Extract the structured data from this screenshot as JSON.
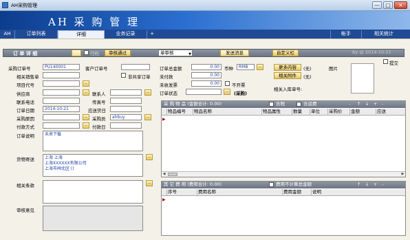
{
  "window": {
    "title": "AH采购管理",
    "buttons": [
      "—",
      "□",
      "×"
    ]
  },
  "banner": {
    "app_title": "AH 采 购 管 理"
  },
  "tabs": [
    {
      "label": "AH"
    },
    {
      "label": "订单列表"
    },
    {
      "label": "详细"
    },
    {
      "label": "业务记录"
    },
    {
      "label": "+"
    }
  ],
  "right_tabs": [
    {
      "label": "帐手"
    },
    {
      "label": "相关统计"
    }
  ],
  "toolbar": {
    "title": "订 单 详 细",
    "checkbox_label": "归档",
    "audit_button": "审核通过",
    "status_select": "单审核",
    "send_button": "发送消息",
    "custom_button": "自定义栏",
    "by_date": "By  @ 2014-10-21"
  },
  "form": {
    "labels": {
      "order_no": "采购订单号",
      "customer_order": "客户订单号",
      "related_sales": "相关销售单",
      "project_code": "项目代号",
      "supplier": "供应商",
      "contact": "联系人",
      "contact_phone": "联系电话",
      "fax": "传真号",
      "order_date": "订单日期",
      "due_date": "应送货日",
      "purchase_reason": "采购原因",
      "buyer": "采购员",
      "payment_method": "付款方式",
      "payment_date": "付款日",
      "order_note": "订单说明",
      "delivery": "货物寄送",
      "terms": "相关条款",
      "audit_opinion": "审核意见",
      "non_original": "非共享订单",
      "total_amount": "订单总金额",
      "currency": "币种",
      "unpaid": "未付款",
      "uninvoiced": "未收发票",
      "no_invoice": "不开票",
      "order_status": "订单状态",
      "status_suffix": "(采购)",
      "more_content": "更多内容",
      "more_content_suffix": "(无)",
      "attachments": "相关附件",
      "attachments_suffix": "(无)",
      "picture": "图片",
      "related_entry": "相关入库单号:",
      "submit_check": "提交"
    },
    "values": {
      "order_no": "PU140001",
      "order_date": "2014-10-21",
      "buyer": "ahbuy",
      "order_note": "未来下载",
      "delivery_lines": [
        "上海 上海",
        "上海XXXXXX有限公司",
        "上海市闸北区 ()"
      ],
      "total_amount": "0.00",
      "currency": "RMB",
      "unpaid": "0.00",
      "uninvoiced": "0.00"
    }
  },
  "purchase_items": {
    "title": "采 购 物 品 (金额合计: 0.00)",
    "checks": [
      "含税",
      "含运费"
    ],
    "controls": [
      "-",
      "↑",
      "↓",
      "+",
      "-"
    ],
    "columns": [
      "物品编号",
      "物品名称",
      "物品属性",
      "数量",
      "单位",
      "采购价",
      "金额",
      "应送"
    ]
  },
  "other_fees": {
    "title": "其 它 费 用 (费用合计: 0.00)",
    "check": "费用不计算总金额",
    "controls": [
      "↑",
      "↓",
      "+",
      "-"
    ],
    "columns": [
      "序号",
      "费用名称",
      "费用金额",
      "说明"
    ]
  }
}
